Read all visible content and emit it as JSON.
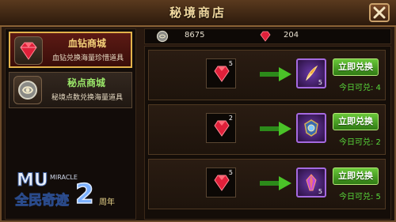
{
  "window": {
    "title": "秘境商店"
  },
  "sidebar": {
    "items": [
      {
        "title": "血钻商城",
        "subtitle": "血钻兑换海量珍惜道具",
        "icon": "red-diamond-icon",
        "selected": true
      },
      {
        "title": "秘点商城",
        "subtitle": "秘境点数兑换海量道具",
        "icon": "secret-coin-icon",
        "selected": false
      }
    ],
    "logo": {
      "line1": "全民奇迹",
      "num": "2",
      "tag": "MIRACLE",
      "badge": "周年"
    }
  },
  "currency": {
    "points": "8675",
    "diamonds": "204"
  },
  "rows": [
    {
      "cost": "5",
      "reward_count": "5",
      "reward_icon": "feather-scroll-icon",
      "button": "立即兑换",
      "today": "今日可兑: 4"
    },
    {
      "cost": "2",
      "reward_count": "",
      "reward_icon": "emblem-icon",
      "button": "立即兑换",
      "today": "今日可兑: 2"
    },
    {
      "cost": "5",
      "reward_count": "5",
      "reward_icon": "purple-crystal-icon",
      "button": "立即兑换",
      "today": "今日可兑: 5"
    }
  ],
  "colors": {
    "accent_gold": "#e2b24a",
    "button_green": "#4aa824",
    "count_green": "#58d83a"
  }
}
